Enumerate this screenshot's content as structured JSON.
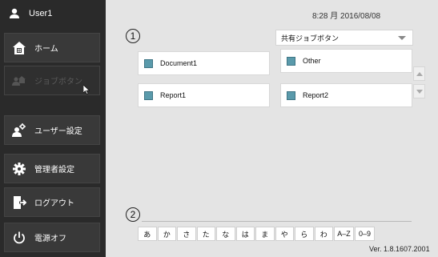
{
  "user": {
    "name": "User1"
  },
  "sidebar": {
    "items": [
      {
        "label": "ホーム",
        "icon": "home-icon"
      },
      {
        "label": "ジョブボタン",
        "icon": "job-button-icon",
        "disabled": true
      },
      {
        "label": "ユーザー設定",
        "icon": "user-settings-icon"
      },
      {
        "label": "管理者設定",
        "icon": "gear-icon"
      },
      {
        "label": "ログアウト",
        "icon": "logout-icon"
      },
      {
        "label": "電源オフ",
        "icon": "power-icon"
      }
    ]
  },
  "header": {
    "datetime": "8:28 月 2016/08/08"
  },
  "markers": {
    "one": "1",
    "two": "2"
  },
  "dropdown": {
    "selected": "共有ジョブボタン"
  },
  "job_buttons": [
    {
      "label": "Document1"
    },
    {
      "label": "Other"
    },
    {
      "label": "Report1"
    },
    {
      "label": "Report2"
    }
  ],
  "kana_filter": [
    "あ",
    "か",
    "さ",
    "た",
    "な",
    "は",
    "ま",
    "や",
    "ら",
    "わ",
    "A–Z",
    "0–9"
  ],
  "version": "Ver. 1.8.1607.2001",
  "colors": {
    "sidebar_bg": "#2a2a2a",
    "main_bg": "#e4e4e4",
    "job_square": "#5a9aab"
  }
}
